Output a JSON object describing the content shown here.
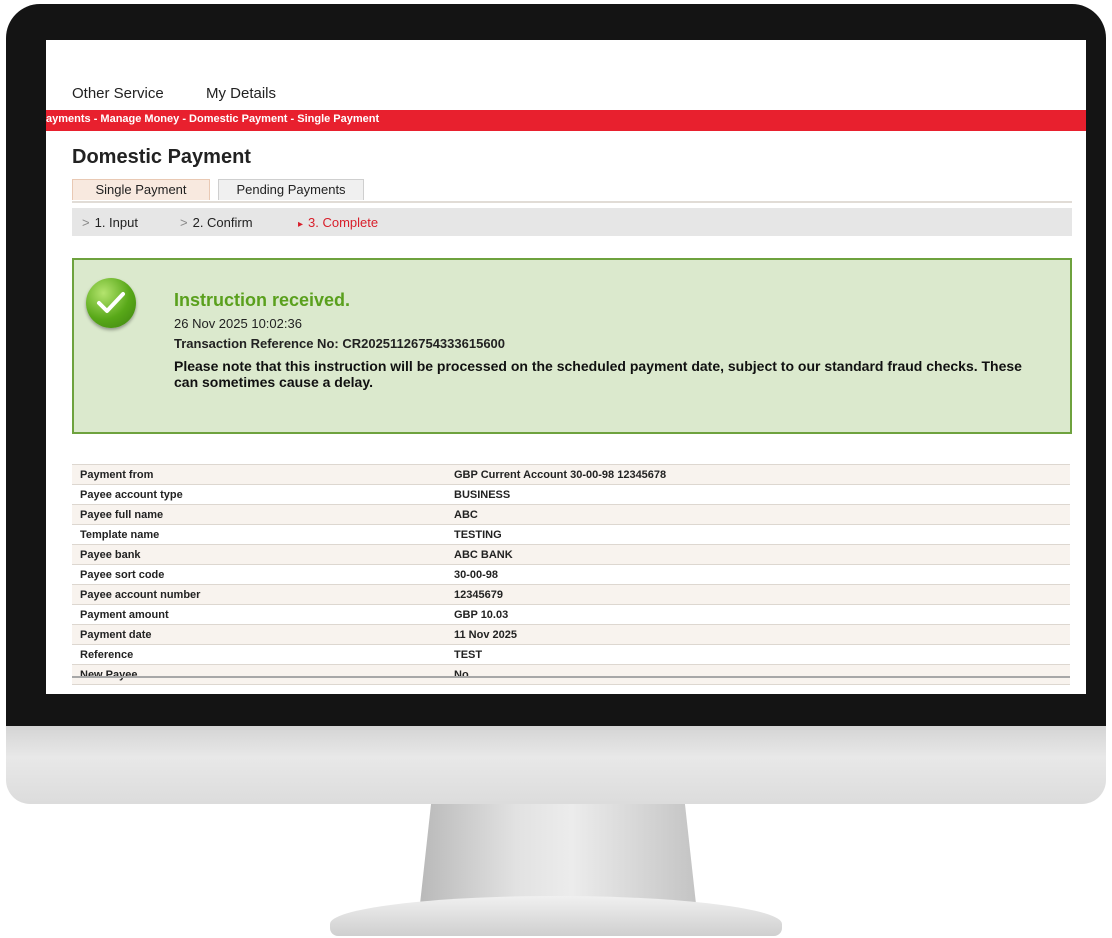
{
  "nav": {
    "items": [
      "Other Service",
      "My Details"
    ]
  },
  "breadcrumb": {
    "text": "ayments - Manage Money - Domestic Payment - Single Payment"
  },
  "page": {
    "title": "Domestic Payment"
  },
  "tabs": [
    {
      "label": "Single Payment",
      "active": true
    },
    {
      "label": "Pending Payments",
      "active": false
    }
  ],
  "steps": [
    {
      "marker": ">",
      "label": "1. Input"
    },
    {
      "marker": ">",
      "label": "2. Confirm"
    },
    {
      "marker": "▸",
      "label": "3. Complete",
      "current": true
    }
  ],
  "confirmation": {
    "icon": "check-circle-icon",
    "title": "Instruction received.",
    "datetime": "26 Nov 2025 10:02:36",
    "reference_label": "Transaction Reference No:",
    "reference_value": "CR20251126754333615600",
    "note": "Please note that this instruction will be processed on the scheduled payment date, subject to our standard fraud checks. These can sometimes cause a delay."
  },
  "details": [
    {
      "label": "Payment from",
      "value": "GBP Current Account 30-00-98 12345678"
    },
    {
      "label": "Payee account type",
      "value": "BUSINESS"
    },
    {
      "label": "Payee full name",
      "value": "ABC"
    },
    {
      "label": "Template name",
      "value": "TESTING"
    },
    {
      "label": "Payee bank",
      "value": "ABC BANK"
    },
    {
      "label": "Payee sort code",
      "value": "30-00-98"
    },
    {
      "label": "Payee account number",
      "value": "12345679"
    },
    {
      "label": "Payment amount",
      "value": "GBP  10.03"
    },
    {
      "label": "Payment date",
      "value": "11 Nov 2025"
    },
    {
      "label": "Reference",
      "value": "TEST"
    },
    {
      "label": "New Payee",
      "value": "No"
    }
  ],
  "colors": {
    "brand_red": "#e8202e",
    "success_green": "#5aa01d",
    "success_bg": "#dbe9cd"
  }
}
